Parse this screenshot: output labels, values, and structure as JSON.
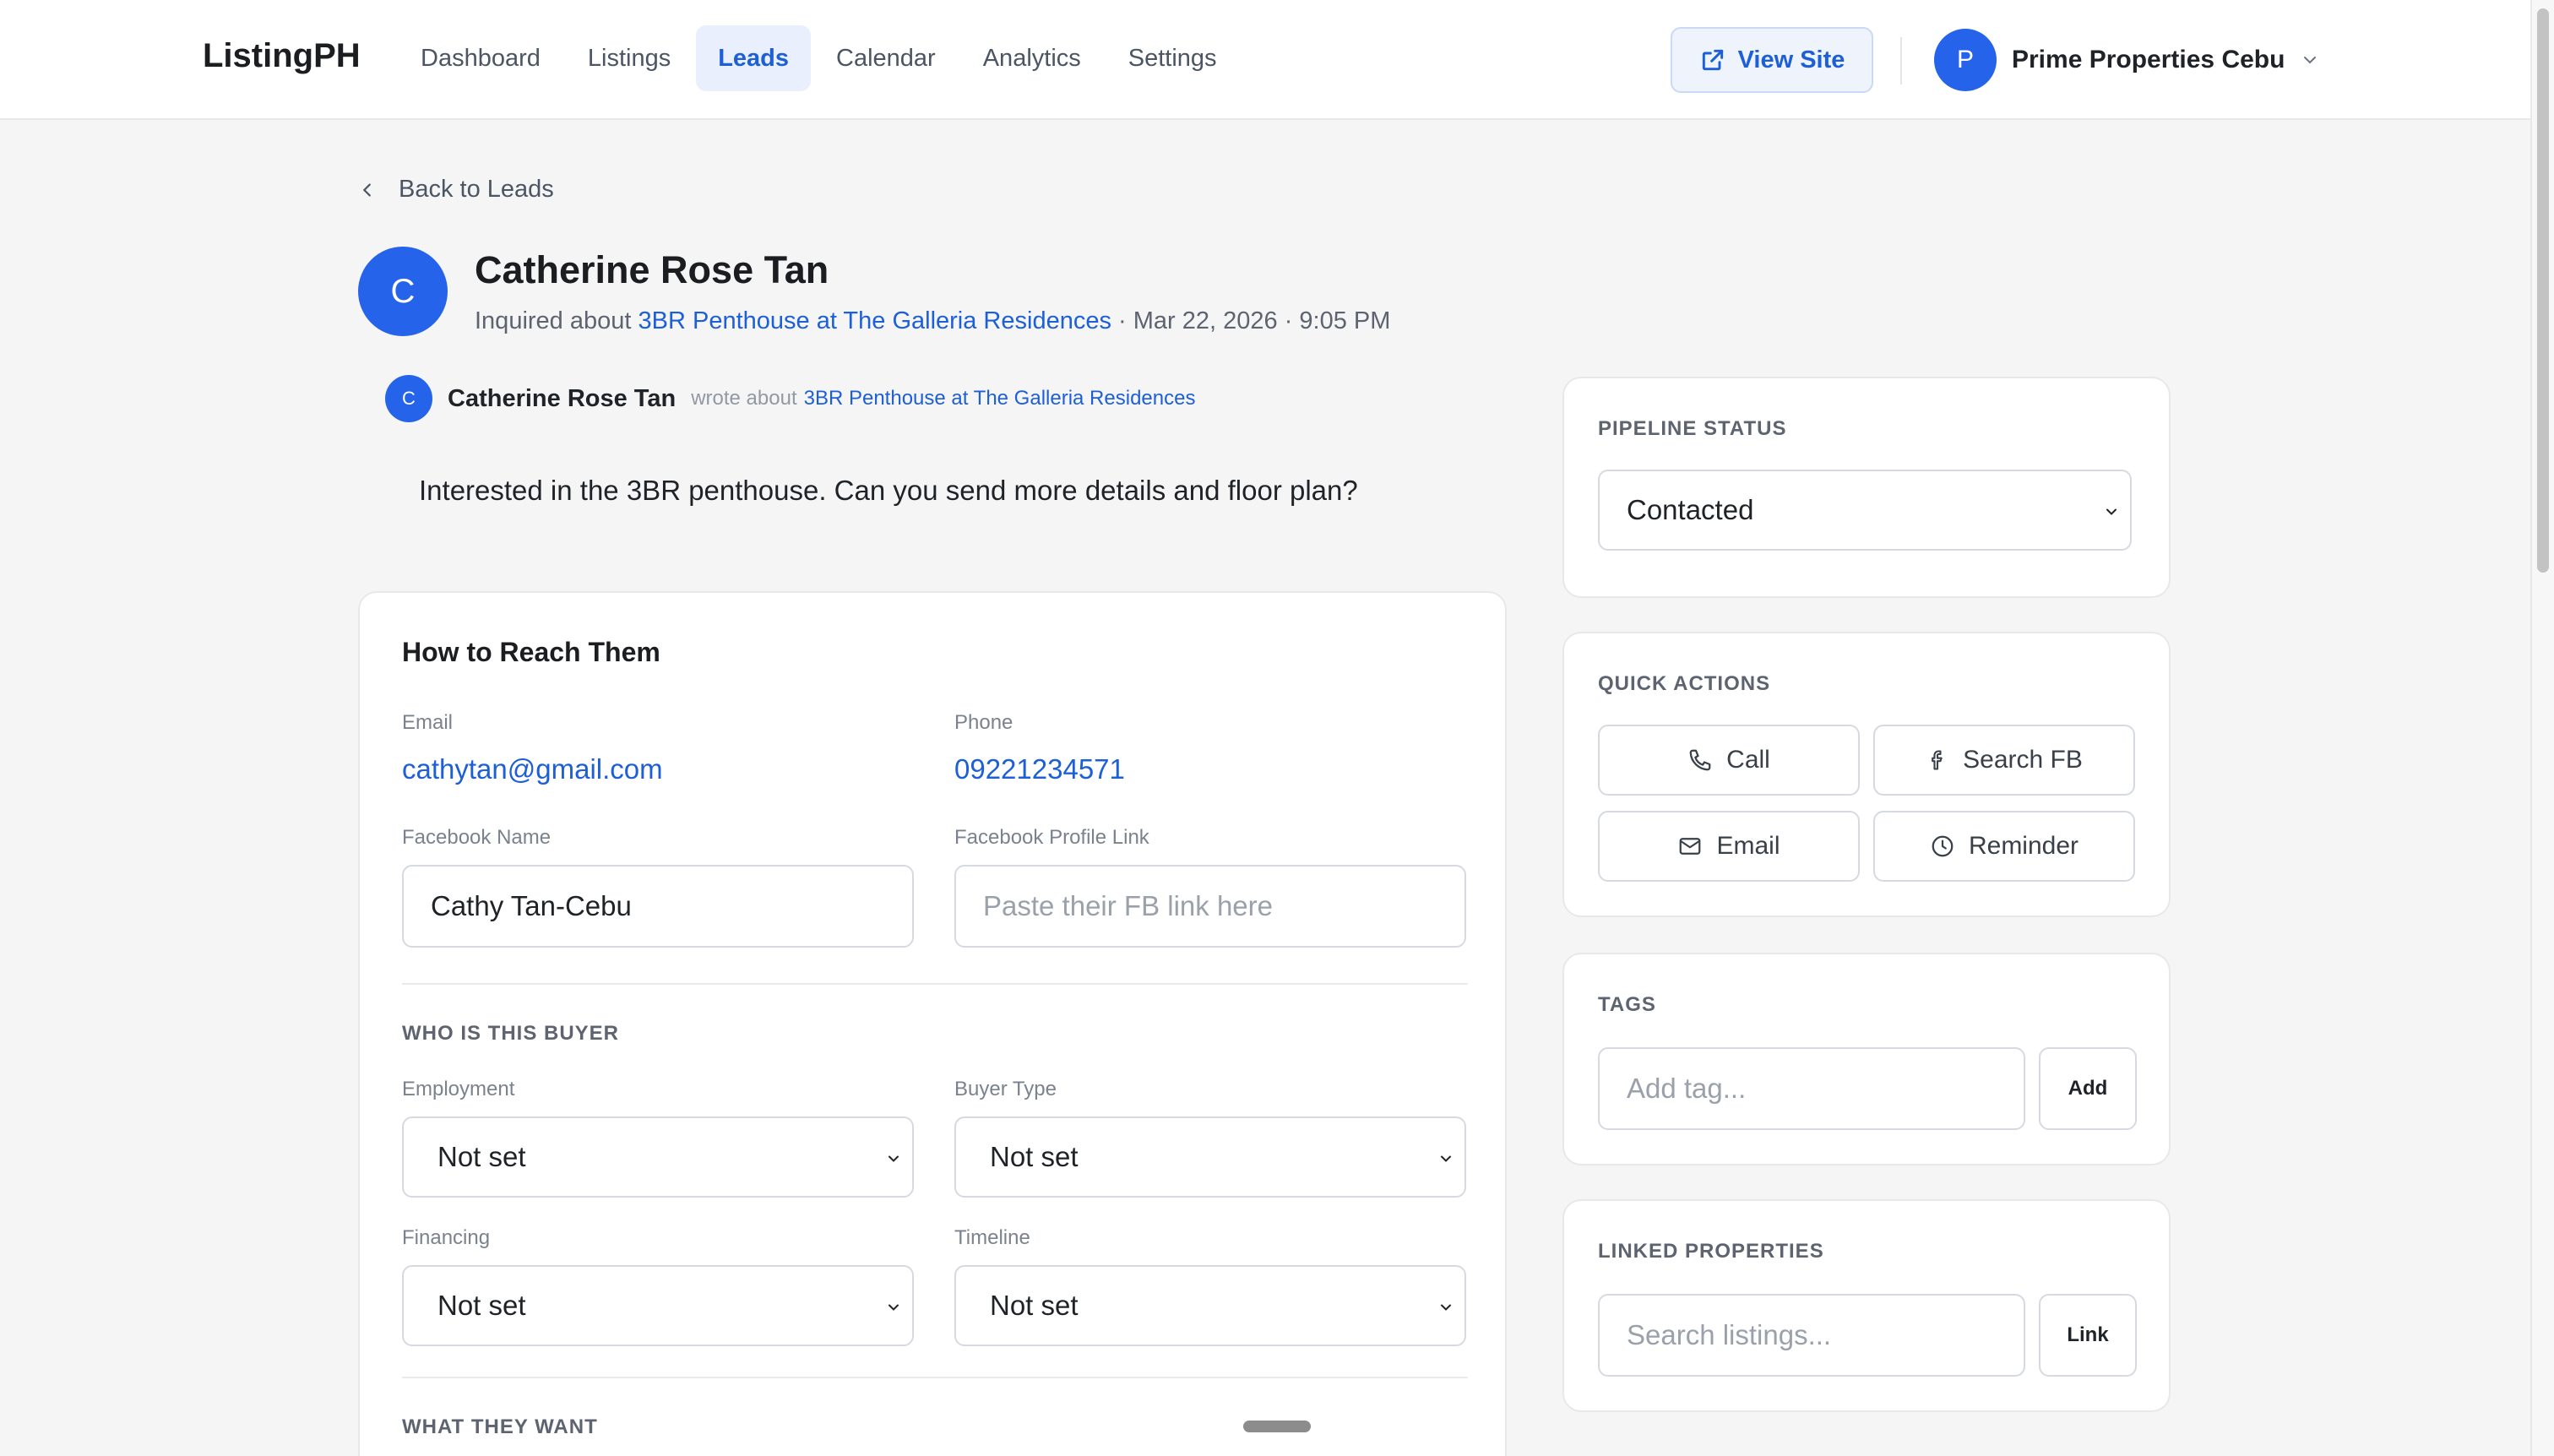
{
  "app": {
    "logo": "ListingPH"
  },
  "nav": [
    {
      "label": "Dashboard"
    },
    {
      "label": "Listings"
    },
    {
      "label": "Leads",
      "active": true
    },
    {
      "label": "Calendar"
    },
    {
      "label": "Analytics"
    },
    {
      "label": "Settings"
    }
  ],
  "header": {
    "view_site_label": "View Site",
    "user_initial": "P",
    "user_name": "Prime Properties Cebu"
  },
  "back_label": "Back to Leads",
  "lead": {
    "initial": "C",
    "name": "Catherine Rose Tan",
    "inquired_prefix": "Inquired about",
    "property": "3BR Penthouse at The Galleria Residences",
    "date": "· Mar 22, 2026 · 9:05 PM"
  },
  "message": {
    "initial": "C",
    "author": "Catherine Rose Tan",
    "wrote_about": "wrote about",
    "property": "3BR Penthouse at The Galleria Residences",
    "text": "Interested in the 3BR penthouse. Can you send more details and floor plan?"
  },
  "contact": {
    "title": "How to Reach Them",
    "email_label": "Email",
    "email": "cathytan@gmail.com",
    "phone_label": "Phone",
    "phone": "09221234571",
    "fb_name_label": "Facebook Name",
    "fb_name": "Cathy Tan-Cebu",
    "fb_link_label": "Facebook Profile Link",
    "fb_link_placeholder": "Paste their FB link here"
  },
  "buyer": {
    "section": "WHO IS THIS BUYER",
    "employment_label": "Employment",
    "employment": "Not set",
    "buyer_type_label": "Buyer Type",
    "buyer_type": "Not set",
    "financing_label": "Financing",
    "financing": "Not set",
    "timeline_label": "Timeline",
    "timeline": "Not set"
  },
  "wants": {
    "section": "WHAT THEY WANT"
  },
  "pipeline": {
    "label": "PIPELINE STATUS",
    "status": "Contacted"
  },
  "quick_actions": {
    "label": "QUICK ACTIONS",
    "call": "Call",
    "search_fb": "Search FB",
    "email": "Email",
    "reminder": "Reminder"
  },
  "tags": {
    "label": "TAGS",
    "placeholder": "Add tag...",
    "add_label": "Add"
  },
  "linked": {
    "label": "LINKED PROPERTIES",
    "placeholder": "Search listings...",
    "link_label": "Link"
  },
  "colors": {
    "accent": "#2563eb",
    "link": "#1d5fd6",
    "background": "#f5f5f6"
  },
  "icons": [
    "external-link-icon",
    "chevron-down-icon",
    "chevron-left-icon",
    "phone-icon",
    "facebook-icon",
    "mail-icon",
    "clock-icon"
  ]
}
